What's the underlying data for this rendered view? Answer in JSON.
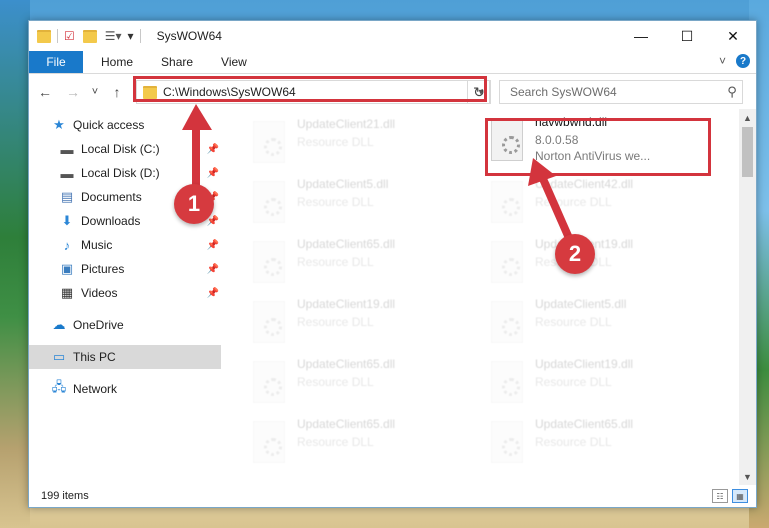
{
  "window": {
    "title": "SysWOW64",
    "controls": {
      "minimize": "—",
      "maximize": "☐",
      "close": "✕"
    }
  },
  "ribbon": {
    "tabs": [
      "File",
      "Home",
      "Share",
      "View"
    ],
    "help": "?"
  },
  "navigation": {
    "back": "←",
    "forward": "→",
    "recent": "˅",
    "up": "↑",
    "address": "C:\\Windows\\SysWOW64",
    "search_placeholder": "Search SysWOW64"
  },
  "sidebar": {
    "quick_access": "Quick access",
    "items": [
      {
        "label": "Local Disk (C:)",
        "icon": "drive-icon"
      },
      {
        "label": "Local Disk (D:)",
        "icon": "drive-icon"
      },
      {
        "label": "Documents",
        "icon": "documents-icon"
      },
      {
        "label": "Downloads",
        "icon": "download-icon"
      },
      {
        "label": "Music",
        "icon": "music-icon"
      },
      {
        "label": "Pictures",
        "icon": "pictures-icon"
      },
      {
        "label": "Videos",
        "icon": "videos-icon"
      }
    ],
    "onedrive": "OneDrive",
    "this_pc": "This PC",
    "network": "Network"
  },
  "files": {
    "highlighted": {
      "name": "navwbwnd.dll",
      "version": "8.0.0.58",
      "company": "Norton AntiVirus we..."
    },
    "left_column": [
      {
        "name": "UpdateClient21.dll",
        "type": "Resource DLL"
      },
      {
        "name": "UpdateClient5.dll",
        "type": "Resource DLL"
      },
      {
        "name": "UpdateClient65.dll",
        "type": "Resource DLL"
      },
      {
        "name": "UpdateClient19.dll",
        "type": "Resource DLL"
      },
      {
        "name": "UpdateClient65.dll",
        "type": "Resource DLL"
      },
      {
        "name": "UpdateClient65.dll",
        "type": "Resource DLL"
      }
    ],
    "right_column": [
      {
        "name": "UpdateClient42.dll",
        "type": "Resource DLL"
      },
      {
        "name": "UpdateClient19.dll",
        "type": "Resource DLL"
      },
      {
        "name": "UpdateClient5.dll",
        "type": "Resource DLL"
      },
      {
        "name": "UpdateClient19.dll",
        "type": "Resource DLL"
      },
      {
        "name": "UpdateClient65.dll",
        "type": "Resource DLL"
      }
    ]
  },
  "status": {
    "item_count": "199 items"
  },
  "annotations": {
    "marker1": "1",
    "marker2": "2",
    "highlight_color": "#d3343d"
  }
}
